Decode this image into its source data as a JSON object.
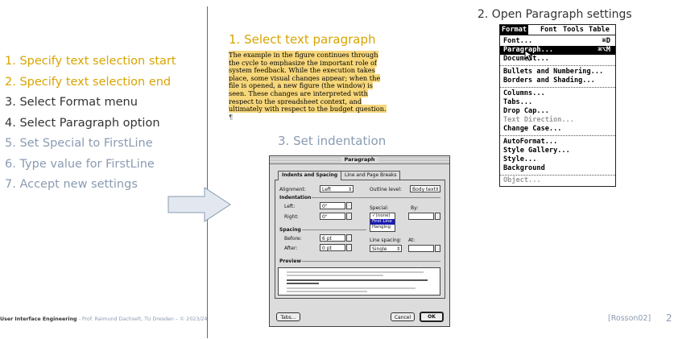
{
  "steps": [
    {
      "text": "1. Specify text selection start",
      "color": "#d9a400"
    },
    {
      "text": "2. Specify text selection end",
      "color": "#d9a400"
    },
    {
      "text": "3. Select Format menu",
      "color": "#333333"
    },
    {
      "text": "4. Select Paragraph option",
      "color": "#333333"
    },
    {
      "text": "5. Set Special to FirstLine",
      "color": "#8a9bb1"
    },
    {
      "text": "6. Type value for FirstLine",
      "color": "#8a9bb1"
    },
    {
      "text": "7. Accept new settings",
      "color": "#8a9bb1"
    }
  ],
  "section1": {
    "title": "1. Select text paragraph",
    "paragraph": "The example in the figure continues through the cycle to emphasize the important role of system feedback. While the execution takes place, some visual changes appear; when the file is opened, a new figure (the window) is seen. These changes are interpreted with respect to the spreadsheet context, and ultimately with respect to the budget question.",
    "pilcrow": "¶"
  },
  "section2": {
    "title": "2. Open Paragraph settings",
    "menubar": [
      "Format",
      "Font",
      "Tools",
      "Table"
    ],
    "items": [
      {
        "label": "Font...",
        "shortcut": "⌘D"
      },
      {
        "label": "Paragraph...",
        "shortcut": "⌘⌥M"
      },
      {
        "label": "Document...",
        "shortcut": ""
      },
      {
        "label": "Bullets and Numbering...",
        "shortcut": ""
      },
      {
        "label": "Borders and Shading...",
        "shortcut": ""
      },
      {
        "label": "Columns...",
        "shortcut": ""
      },
      {
        "label": "Tabs...",
        "shortcut": ""
      },
      {
        "label": "Drop Cap...",
        "shortcut": ""
      },
      {
        "label": "Text Direction...",
        "shortcut": ""
      },
      {
        "label": "Change Case...",
        "shortcut": ""
      },
      {
        "label": "AutoFormat...",
        "shortcut": ""
      },
      {
        "label": "Style Gallery...",
        "shortcut": ""
      },
      {
        "label": "Style...",
        "shortcut": ""
      },
      {
        "label": "Background",
        "shortcut": ""
      },
      {
        "label": "Object...",
        "shortcut": ""
      }
    ]
  },
  "section3": {
    "title": "3. Set indentation",
    "dialog": {
      "title": "Paragraph",
      "tab_active": "Indents and Spacing",
      "tab_inactive": "Line and Page Breaks",
      "alignment_label": "Alignment:",
      "alignment_value": "Left",
      "outline_label": "Outline level:",
      "outline_value": "Body text",
      "indentation_label": "Indentation",
      "left_label": "Left:",
      "left_value": "0\"",
      "right_label": "Right:",
      "right_value": "0\"",
      "special_label": "Special:",
      "special_options": [
        "✓(none)",
        "First Line",
        "Hanging"
      ],
      "by_label": "By:",
      "spacing_label": "Spacing",
      "before_label": "Before:",
      "before_value": "6 pt",
      "after_label": "After:",
      "after_value": "0 pt",
      "line_spacing_label": "Line spacing:",
      "line_spacing_value": "Single",
      "at_label": "At:",
      "preview_label": "Preview",
      "tabs_button": "Tabs...",
      "cancel_button": "Cancel",
      "ok_button": "OK"
    }
  },
  "footer": {
    "course": "User Interface Engineering",
    "rest": " - Prof. Raimund Dachselt, TU Dresden – © 2023/24"
  },
  "reference": "[Rosson02]",
  "page_number": "2"
}
